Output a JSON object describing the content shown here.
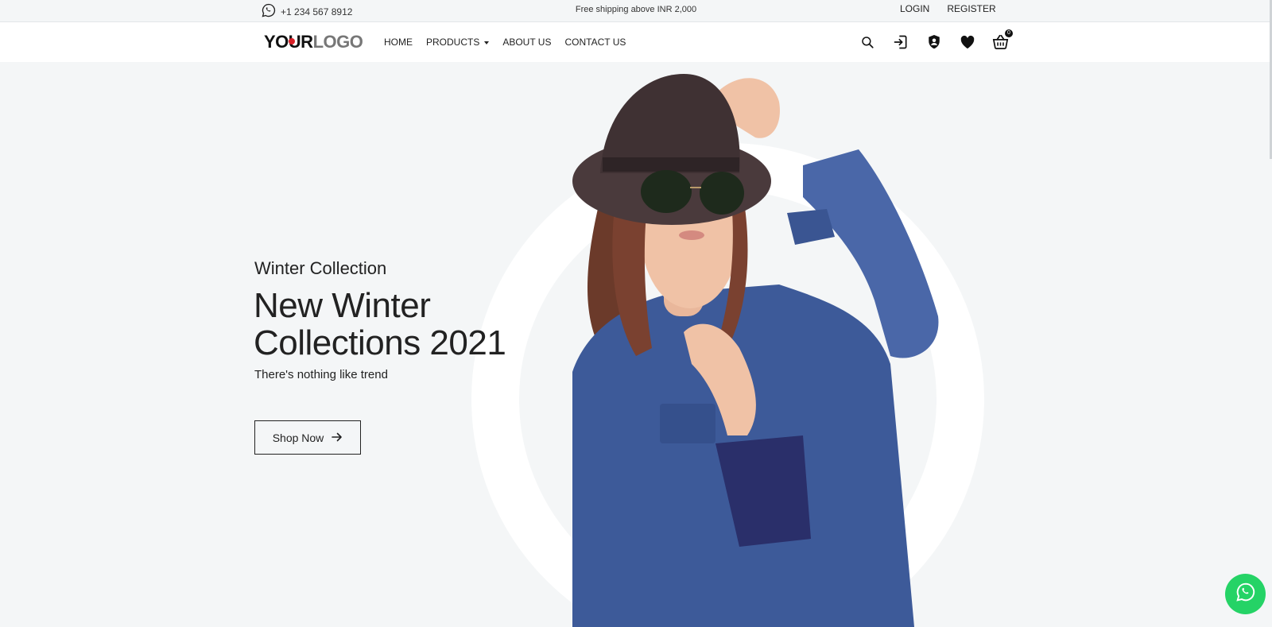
{
  "topbar": {
    "phone": "+1 234 567 8912",
    "shipping": "Free shipping above INR 2,000",
    "login": "LOGIN",
    "register": "REGISTER"
  },
  "header": {
    "logo_part1": "YOUR",
    "logo_part2": "LOGO",
    "nav": {
      "home": "HOME",
      "products": "PRODUCTS",
      "about": "ABOUT US",
      "contact": "CONTACT US"
    },
    "cart_count": "0",
    "icons": [
      "search-icon",
      "login-icon",
      "account-shield-icon",
      "heart-icon",
      "basket-icon"
    ]
  },
  "hero": {
    "subtitle": "Winter Collection",
    "title": "New Winter Collections 2021",
    "tagline": "There's nothing like trend",
    "cta": "Shop Now"
  },
  "colors": {
    "background": "#f4f6f7",
    "accent_logo_dot": "#d92027",
    "whatsapp": "#25d366",
    "denim": "#3d5a99"
  }
}
